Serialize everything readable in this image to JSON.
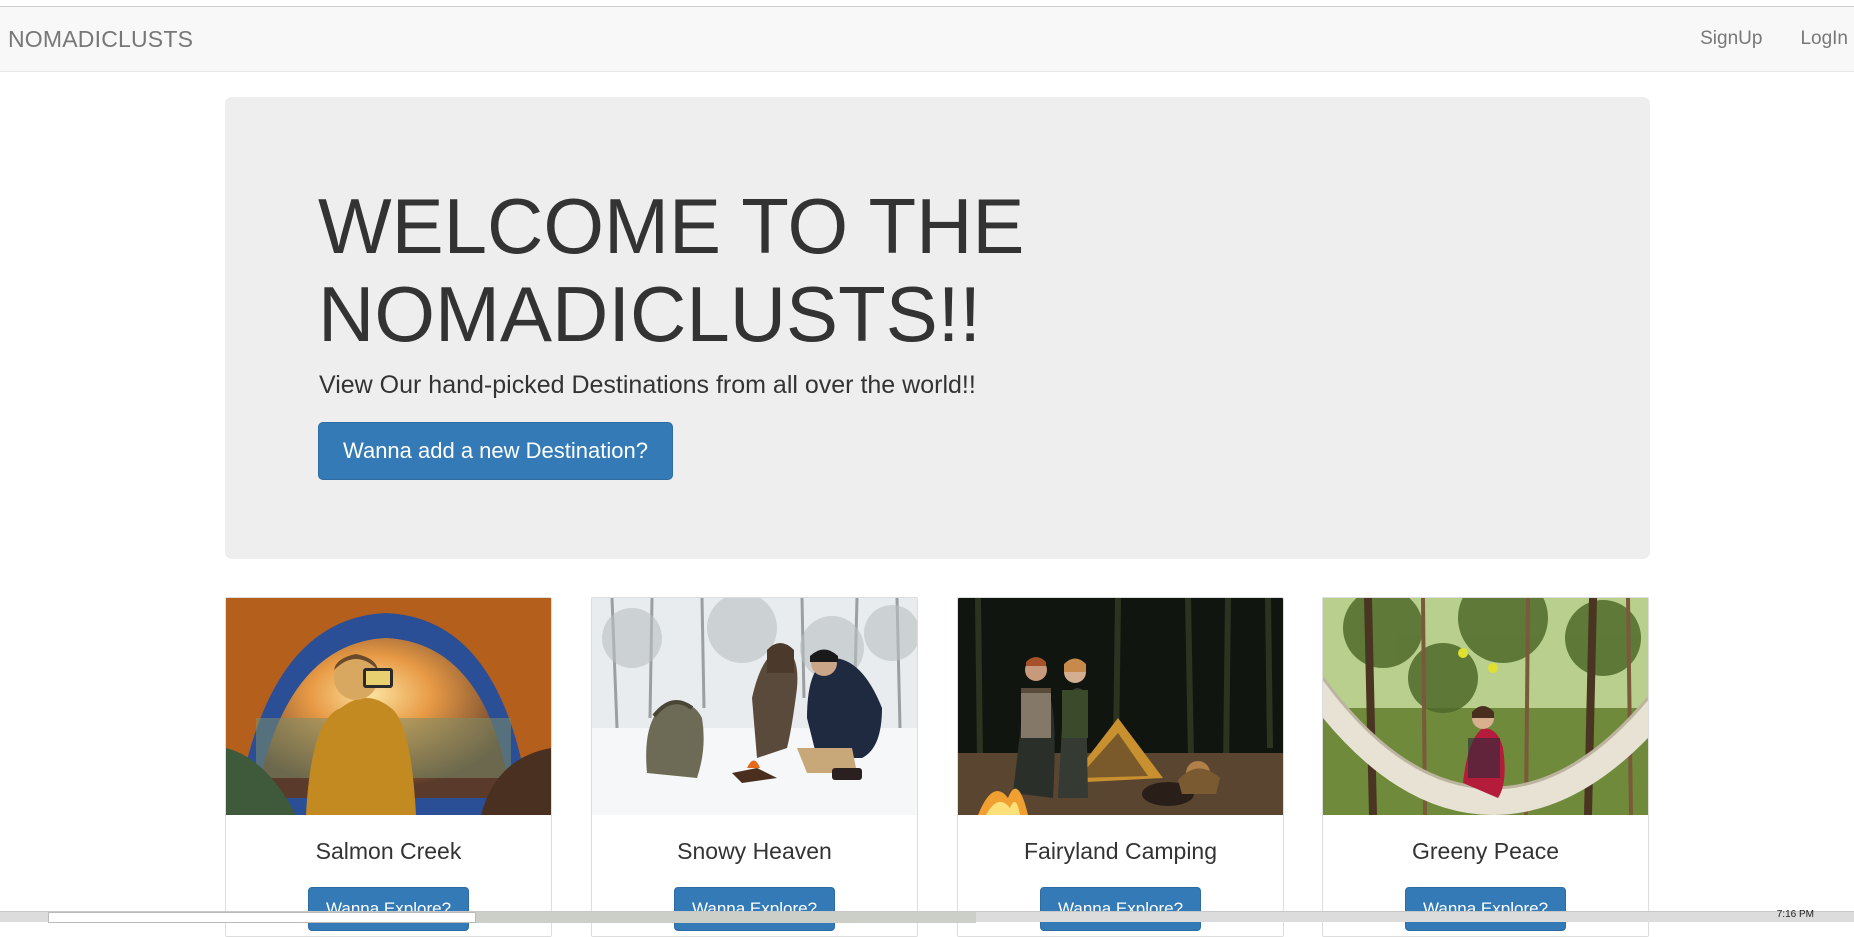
{
  "navbar": {
    "brand": "NOMADICLUSTS",
    "links": [
      {
        "label": "SignUp"
      },
      {
        "label": "LogIn"
      }
    ]
  },
  "jumbotron": {
    "title": "WELCOME TO THE NOMADICLUSTS!!",
    "subtitle": "View Our hand-picked Destinations from all over the world!!",
    "button_label": "Wanna add a new Destination?"
  },
  "cards": [
    {
      "name": "Salmon Creek",
      "button_label": "Wanna Explore?",
      "image_icon": "tent-sunset-photo"
    },
    {
      "name": "Snowy Heaven",
      "button_label": "Wanna Explore?",
      "image_icon": "snow-campfire-photo"
    },
    {
      "name": "Fairyland Camping",
      "button_label": "Wanna Explore?",
      "image_icon": "night-campfire-photo"
    },
    {
      "name": "Greeny Peace",
      "button_label": "Wanna Explore?",
      "image_icon": "forest-hammock-photo"
    }
  ],
  "taskbar": {
    "clock": "7:16 PM"
  },
  "colors": {
    "primary": "#337ab7",
    "navbar_bg": "#f8f8f8",
    "jumbotron_bg": "#eeeeee",
    "text": "#333333",
    "nav_text": "#777777"
  }
}
